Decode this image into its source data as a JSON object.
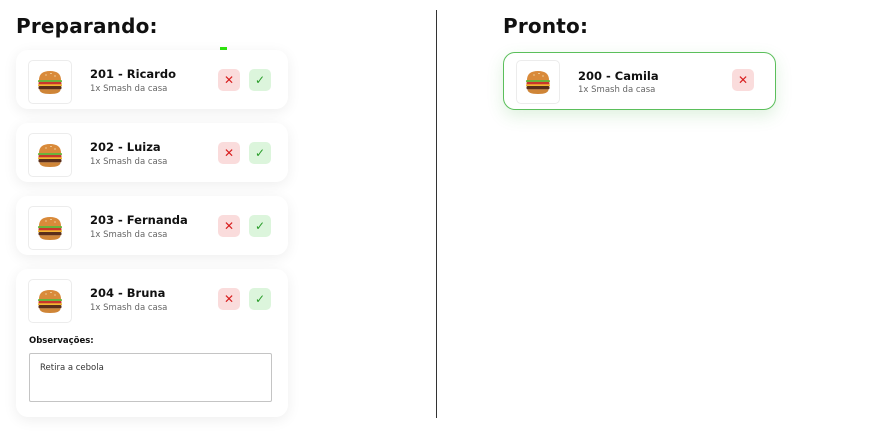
{
  "columns": {
    "preparing": {
      "title": "Preparando:"
    },
    "ready": {
      "title": "Pronto:"
    }
  },
  "icons": {
    "cancel": "✕",
    "confirm": "✓",
    "burger": "burger-icon"
  },
  "colors": {
    "cancel_bg": "#fadcdc",
    "cancel_fg": "#d81e1e",
    "confirm_bg": "#dcf5dc",
    "confirm_fg": "#2a9d2a",
    "ready_border": "#5bbf5b",
    "marker": "#2ee60f"
  },
  "preparing_orders": [
    {
      "title": "201 - Ricardo",
      "item": "1x Smash da casa"
    },
    {
      "title": "202 - Luiza",
      "item": "1x Smash da casa"
    },
    {
      "title": "203 - Fernanda",
      "item": "1x Smash da casa"
    },
    {
      "title": "204 - Bruna",
      "item": "1x Smash da casa",
      "notes_label": "Observações:",
      "notes": "Retira a cebola"
    }
  ],
  "ready_orders": [
    {
      "title": "200 - Camila",
      "item": "1x Smash da casa"
    }
  ]
}
